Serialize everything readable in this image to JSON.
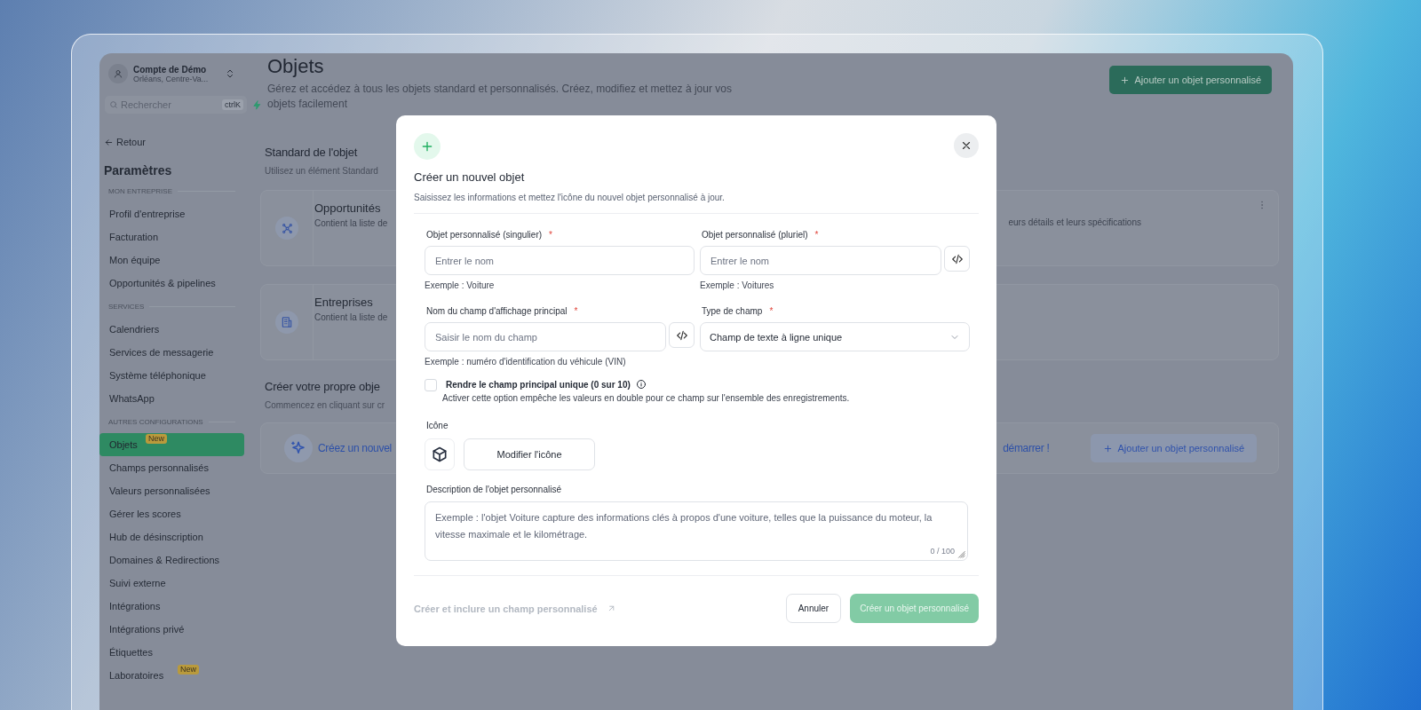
{
  "account": {
    "name": "Compte de Démo",
    "location": "Orléans, Centre-Va..."
  },
  "search": {
    "placeholder": "Rechercher",
    "shortcut": "ctrlK"
  },
  "back": "Retour",
  "sidebar": {
    "title": "Paramètres",
    "sections": [
      {
        "label": "MON ENTREPRISE",
        "items": [
          {
            "label": "Profil d'entreprise",
            "selected": false
          },
          {
            "label": "Facturation",
            "selected": false
          },
          {
            "label": "Mon équipe",
            "selected": false
          },
          {
            "label": "Opportunités & pipelines",
            "selected": false
          }
        ]
      },
      {
        "label": "SERVICES",
        "items": [
          {
            "label": "Calendriers",
            "selected": false
          },
          {
            "label": "Services de messagerie",
            "selected": false
          },
          {
            "label": "Système téléphonique",
            "selected": false
          },
          {
            "label": "WhatsApp",
            "selected": false
          }
        ]
      },
      {
        "label": "AUTRES CONFIGURATIONS",
        "items": [
          {
            "label": "Objets",
            "selected": true,
            "badge": "New"
          },
          {
            "label": "Champs personnalisés",
            "selected": false
          },
          {
            "label": "Valeurs personnalisées",
            "selected": false
          },
          {
            "label": "Gérer les scores",
            "selected": false
          },
          {
            "label": "Hub de désinscription",
            "selected": false
          },
          {
            "label": "Domaines & Redirections",
            "selected": false
          },
          {
            "label": "Suivi externe",
            "selected": false
          },
          {
            "label": "Intégrations",
            "selected": false
          },
          {
            "label": "Intégrations privé",
            "selected": false
          },
          {
            "label": "Étiquettes",
            "selected": false
          },
          {
            "label": "Laboratoires",
            "selected": false,
            "badge": "New"
          }
        ]
      }
    ]
  },
  "page": {
    "title": "Objets",
    "subtitle": "Gérez et accédez à tous les objets standard et personnalisés. Créez, modifiez et mettez à jour vos objets facilement",
    "add_button": "Ajouter un objet personnalisé"
  },
  "standard": {
    "heading": "Standard de l'objet",
    "description": "Utilisez un élément Standard",
    "cards": [
      {
        "kind": "network",
        "name": "Opportunités",
        "description": "Contient la liste de",
        "description_end": "eurs détails et leurs spécifications",
        "menu": true
      },
      {
        "kind": "building",
        "name": "Entreprises",
        "description": "Contient la liste de",
        "menu": false
      }
    ]
  },
  "custom": {
    "heading": "Créer votre propre obje",
    "description": "Commencez en cliquant sur cr",
    "banner_text": "Créez un nouvel",
    "banner_text_end": "démarrer !",
    "button": "Ajouter un objet personnalisé"
  },
  "modal": {
    "title": "Créer un nouvel objet",
    "subtitle": "Saisissez les informations et mettez l'icône du nouvel objet personnalisé à jour.",
    "fields": [
      {
        "kind": "text",
        "label": "Objet personnalisé (singulier)",
        "required_mark": "*",
        "placeholder": "Entrer le nom",
        "hint": "Exemple : Voiture",
        "code_button": false
      },
      {
        "kind": "text",
        "label": "Objet personnalisé (pluriel)",
        "required_mark": "*",
        "placeholder": "Entrer le nom",
        "hint": "Exemple : Voitures",
        "code_button": true
      },
      {
        "kind": "text",
        "label": "Nom du champ d'affichage principal",
        "required_mark": "*",
        "placeholder": "Saisir le nom du champ",
        "hint": "Exemple : numéro d'identification du véhicule (VIN)",
        "code_button": true
      },
      {
        "kind": "select",
        "label": "Type de champ",
        "required_mark": "*",
        "value": "Champ de texte à ligne unique",
        "code_button": false
      }
    ],
    "checkbox": {
      "label": "Rendre le champ principal unique (0 sur 10)",
      "description": "Activer cette option empêche les valeurs en double pour ce champ sur l'ensemble des enregistrements.",
      "checked": false
    },
    "icon_section": {
      "label": "Icône",
      "button": "Modifier l'icône"
    },
    "description": {
      "label": "Description de l'objet personnalisé",
      "placeholder": "Exemple : l'objet Voiture capture des informations clés à propos d'une voiture, telles que la puissance du moteur, la vitesse maximale et le kilométrage.",
      "counter": "0 / 100"
    },
    "footer": {
      "link": "Créer et inclure un champ personnalisé",
      "link_disabled": true,
      "cancel": "Annuler",
      "submit": "Créer un objet personnalisé",
      "submit_disabled": true
    }
  }
}
